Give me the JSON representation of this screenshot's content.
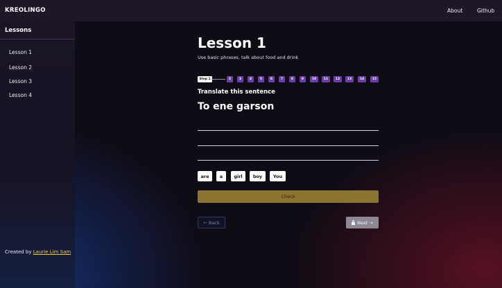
{
  "header": {
    "brand": "KREOLINGO",
    "nav": [
      {
        "label": "About"
      },
      {
        "label": "Github"
      }
    ]
  },
  "sidebar": {
    "title": "Lessons",
    "items": [
      {
        "label": "Lesson 1"
      },
      {
        "label": "Lesson 2"
      },
      {
        "label": "Lesson 3"
      },
      {
        "label": "Lesson 4"
      }
    ],
    "footer_prefix": "Created by ",
    "footer_link": "Laurie Lim Sam"
  },
  "main": {
    "title": "Lesson 1",
    "subtitle": "Use basic phrases, talk about food and drink",
    "steps": {
      "active_label": "Step 1",
      "items": [
        "2",
        "3",
        "4",
        "5",
        "6",
        "7",
        "8",
        "9",
        "10",
        "11",
        "12",
        "13",
        "14",
        "15"
      ]
    },
    "prompt": "Translate this sentence",
    "sentence": "To ene garson",
    "word_bank": [
      "are",
      "a",
      "girl",
      "boy",
      "You"
    ],
    "check_label": "Check",
    "back_label": "← Back",
    "next_label": "Next →"
  },
  "colors": {
    "step_accent": "#6c3fa8",
    "check_button": "#8a7430",
    "footer_link": "#f2c94c"
  },
  "icons": [
    "lock-icon"
  ]
}
